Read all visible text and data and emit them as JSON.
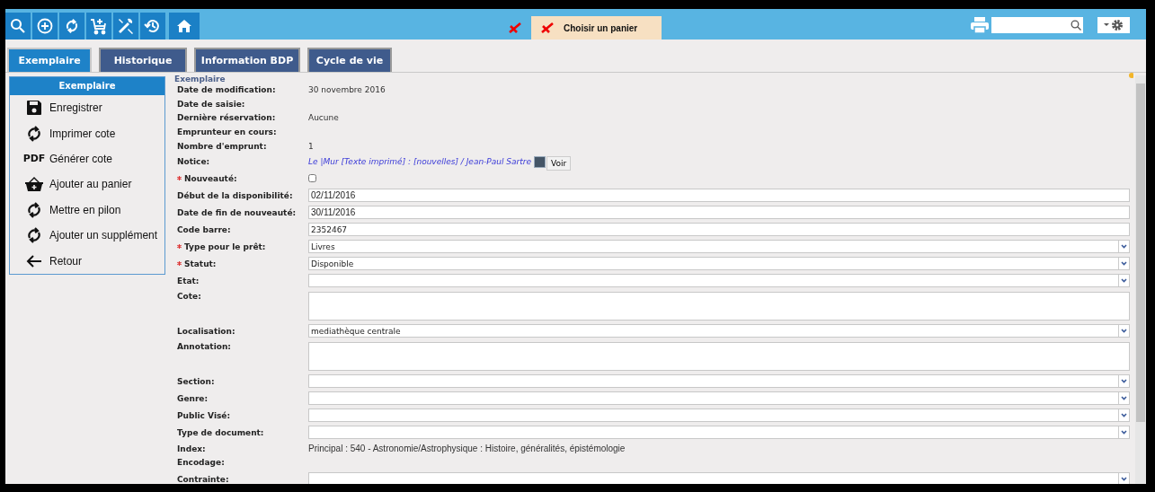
{
  "toolbar": {
    "cart_status": "Choisir un panier"
  },
  "tabs": [
    {
      "label": "Exemplaire",
      "selected": true
    },
    {
      "label": "Historique",
      "selected": false
    },
    {
      "label": "Information BDP",
      "selected": false
    },
    {
      "label": "Cycle de vie",
      "selected": false
    }
  ],
  "sidebar": {
    "title": "Exemplaire",
    "items": [
      {
        "label": "Enregistrer",
        "kind": "save"
      },
      {
        "label": "Imprimer cote",
        "kind": "refresh"
      },
      {
        "label": "Générer cote",
        "kind": "pdf",
        "badge": "PDF"
      },
      {
        "label": "Ajouter au panier",
        "kind": "basket"
      },
      {
        "label": "Mettre en pilon",
        "kind": "refresh"
      },
      {
        "label": "Ajouter un supplément",
        "kind": "refresh"
      },
      {
        "label": "Retour",
        "kind": "back"
      }
    ]
  },
  "form": {
    "section": "Exemplaire",
    "rows": [
      {
        "label": "Date de modification:",
        "kind": "text",
        "value": "30 novembre 2016",
        "required": false
      },
      {
        "label": "Date de saisie:",
        "kind": "text",
        "required": false
      },
      {
        "label": "Dernière réservation:",
        "kind": "text",
        "value": "Aucune",
        "required": false
      },
      {
        "label": "Emprunteur en cours:",
        "kind": "text",
        "required": false
      },
      {
        "label": "Nombre d'emprunt:",
        "kind": "text",
        "value": "1",
        "required": false
      },
      {
        "label": "Notice:",
        "kind": "link",
        "value": "Le |Mur [Texte imprimé] : [nouvelles] / Jean-Paul Sartre",
        "button": "Voir",
        "required": false
      },
      {
        "label": "Nouveauté:",
        "kind": "checkbox",
        "checked": false,
        "required": true
      },
      {
        "label": "Début de la disponibilité:",
        "kind": "input",
        "value": "02/11/2016",
        "required": false
      },
      {
        "label": "Date de fin de nouveauté:",
        "kind": "input",
        "value": "30/11/2016",
        "required": false
      },
      {
        "label": "Code barre:",
        "kind": "input",
        "value": "2352467",
        "required": false
      },
      {
        "label": "Type pour le prêt:",
        "kind": "select",
        "value": "Livres",
        "required": true
      },
      {
        "label": "Statut:",
        "kind": "select",
        "value": "Disponible",
        "required": true
      },
      {
        "label": "Etat:",
        "kind": "select",
        "required": false
      },
      {
        "label": "Cote:",
        "kind": "textarea",
        "required": false
      },
      {
        "label": "Localisation:",
        "kind": "select",
        "value": "mediathèque centrale",
        "required": false
      },
      {
        "label": "Annotation:",
        "kind": "textarea",
        "required": false
      },
      {
        "label": "Section:",
        "kind": "select",
        "required": false
      },
      {
        "label": "Genre:",
        "kind": "select",
        "required": false
      },
      {
        "label": "Public Visé:",
        "kind": "select",
        "required": false
      },
      {
        "label": "Type de document:",
        "kind": "select",
        "required": false
      },
      {
        "label": "Index:",
        "kind": "plain",
        "value": "Principal : 540 - Astronomie/Astrophysique : Histoire, généralités, épistémologie",
        "required": false
      },
      {
        "label": "Encodage:",
        "kind": "text",
        "required": false
      },
      {
        "label": "Contrainte:",
        "kind": "select",
        "required": false
      }
    ]
  }
}
